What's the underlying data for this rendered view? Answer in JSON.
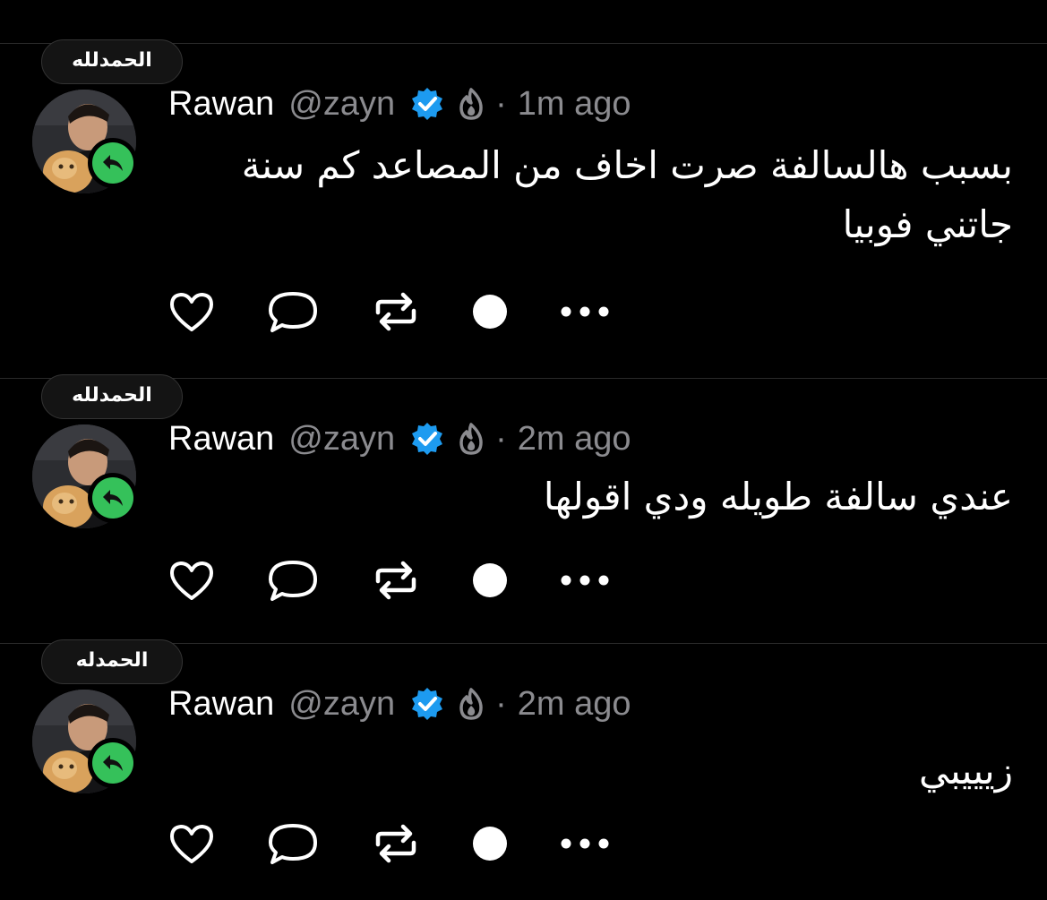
{
  "posts": [
    {
      "badge": "الحمدلله",
      "author": {
        "name": "Rawan",
        "handle": "@zayn"
      },
      "separator": "·",
      "time": "1m ago",
      "text": "بسبب هالسالفة صرت اخاف من المصاعد كم سنة جاتني فوبيا"
    },
    {
      "badge": "الحمدلله",
      "author": {
        "name": "Rawan",
        "handle": "@zayn"
      },
      "separator": "·",
      "time": "2m ago",
      "text": "عندي سالفة طويله ودي اقولها"
    },
    {
      "badge": "الحمدله",
      "author": {
        "name": "Rawan",
        "handle": "@zayn"
      },
      "separator": "·",
      "time": "2m ago",
      "text": "زيييبي"
    }
  ],
  "icons": {
    "verified": "verified-check-icon",
    "flame": "flame-icon",
    "like": "heart-icon",
    "reply": "comment-bubble-icon",
    "repost": "repost-icon",
    "record": "dot-icon",
    "more": "more-dots-icon",
    "avatar_action": "reply-arrow-icon"
  },
  "colors": {
    "background": "#000000",
    "verified": "#1d9bf0",
    "reply_badge": "#35c15a",
    "muted_text": "#8b8b8f"
  }
}
